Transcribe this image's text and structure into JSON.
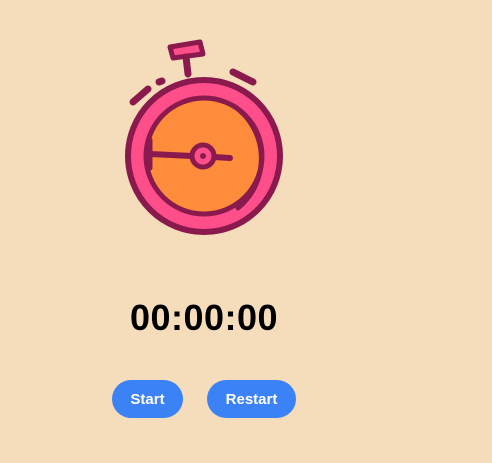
{
  "timer": {
    "display": "00:00:00"
  },
  "controls": {
    "start_label": "Start",
    "restart_label": "Restart"
  },
  "icons": {
    "illustration": "stopwatch-icon"
  },
  "colors": {
    "background": "#f5dcbb",
    "button": "#3b82f6",
    "stopwatch_outline": "#8a1a4d",
    "stopwatch_ring": "#ff4f8b",
    "stopwatch_face": "#ff8c3a"
  }
}
